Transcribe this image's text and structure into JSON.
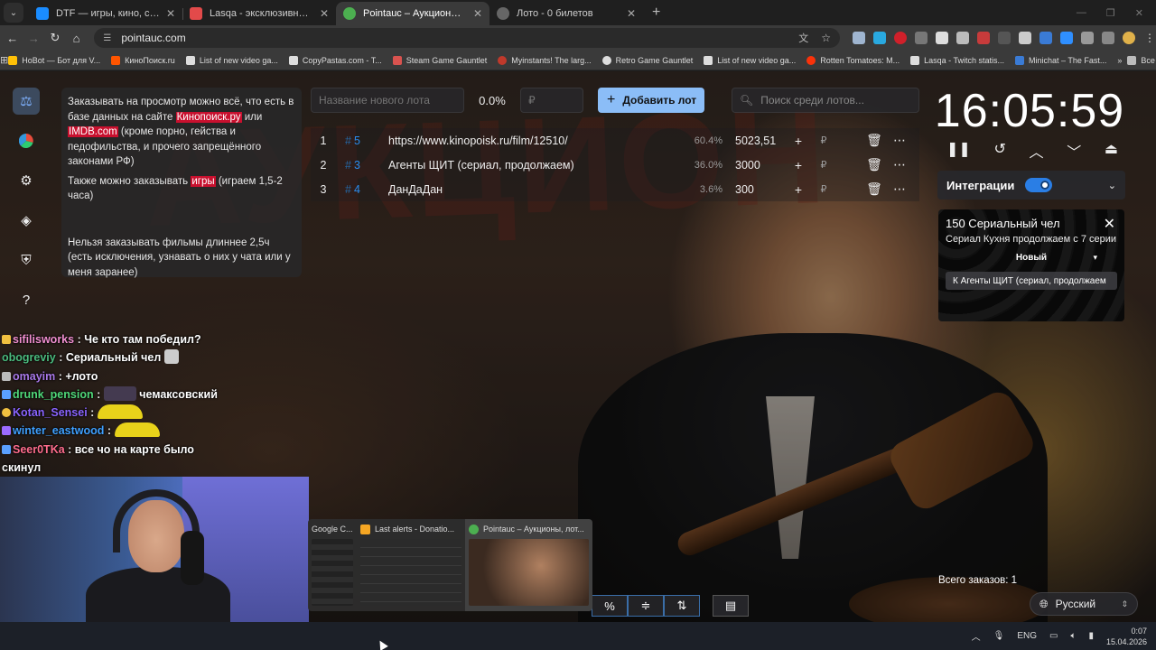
{
  "browser": {
    "tabs": [
      {
        "title": "DTF — игры, кино, сериалы, р",
        "icon": "dtf-icon",
        "color": "#1a8cff",
        "active": false
      },
      {
        "title": "Lasqa - эксклюзивный контен",
        "icon": "lasqa-icon",
        "color": "#e24a4a",
        "active": false
      },
      {
        "title": "Pointauc – Аукционы, лотере",
        "icon": "pointauc-icon",
        "color": "#4caf50",
        "active": true
      },
      {
        "title": "Лото - 0 билетов",
        "icon": "globe-icon",
        "color": "#888888",
        "active": false
      }
    ],
    "url": "pointauc.com",
    "bookmarks": [
      {
        "label": "HoBot — Бот для V...",
        "color": "#ffc107"
      },
      {
        "label": "КиноПоиск.ru",
        "color": "#ff5500"
      },
      {
        "label": "List of new video ga...",
        "color": "#dddddd"
      },
      {
        "label": "CopyPastas.com - T...",
        "color": "#dddddd"
      },
      {
        "label": "Steam Game Gauntlet",
        "color": "#d9534f"
      },
      {
        "label": "Myinstants! The larg...",
        "color": "#c0392b"
      },
      {
        "label": "Retro Game Gauntlet",
        "color": "#dddddd"
      },
      {
        "label": "List of new video ga...",
        "color": "#dddddd"
      },
      {
        "label": "Rotten Tomatoes: M...",
        "color": "#fa320a"
      },
      {
        "label": "Lasqa - Twitch statis...",
        "color": "#dddddd"
      },
      {
        "label": "Minichat – The Fast...",
        "color": "#3a7bd5"
      }
    ],
    "bookmarks_more": "»",
    "all_bookmarks": "Все закладки"
  },
  "info": {
    "p1_a": "Заказывать на просмотр можно всё, что есть в базе данных на сайте ",
    "p1_link1": "Кинопоиск.ру",
    "p1_b": " или ",
    "p1_link2": "IMDB.com",
    "p1_c": " (кроме порно, гейства и педофильства, и прочего запрещённого законами РФ)",
    "p2_a": "Также можно заказывать ",
    "p2_link": "игры",
    "p2_b": " (играем 1,5-2 часа)",
    "p3": "Нельзя заказывать фильмы длиннее 2,5ч (есть исключения, узнавать о них у чата или у меня заранее)"
  },
  "lot_form": {
    "name_placeholder": "Название нового лота",
    "percent": "0.0%",
    "amount_placeholder": "₽",
    "add_button": "Добавить лот",
    "search_placeholder": "Поиск среди лотов..."
  },
  "lots": [
    {
      "n": "1",
      "id": "5",
      "name": "https://www.kinopoisk.ru/film/12510/",
      "share": "60.4%",
      "amount": "5023,51"
    },
    {
      "n": "2",
      "id": "3",
      "name": "Агенты ЩИТ (сериал, продолжаем)",
      "share": "36.0%",
      "amount": "3000"
    },
    {
      "n": "3",
      "id": "4",
      "name": "ДанДаДан",
      "share": "3.6%",
      "amount": "300"
    }
  ],
  "timer": "16:05:59",
  "integrations": {
    "label": "Интеграции",
    "enabled": true
  },
  "donation_card": {
    "title": "150 Сериальный чел",
    "message": "Сериал Кухня продолжаем с 7 серии",
    "select_value": "Новый",
    "target_button": "К Агенты ЩИТ (сериал, продолжаем"
  },
  "total_orders": {
    "label": "Всего заказов:",
    "value": "1"
  },
  "language": "Русский",
  "chat": [
    {
      "user": "sifilisworks",
      "text": "Че кто там победил?",
      "ucls": "u1",
      "badge": "#f0c040"
    },
    {
      "user": "obogreviy",
      "text": "Сериальный чел",
      "ucls": "u2",
      "badge": ""
    },
    {
      "user": "omayim",
      "text": "+лото",
      "ucls": "u3",
      "badge": "#bbbbbb"
    },
    {
      "user": "drunk_pension",
      "text": "чемаксовский",
      "ucls": "u4",
      "badge": "#5aa0ff"
    },
    {
      "user": "Kotan_Sensei",
      "text": "",
      "ucls": "u5",
      "badge": "#f0c040"
    },
    {
      "user": "winter_eastwood",
      "text": "",
      "ucls": "u6",
      "badge": "#9b6bff"
    },
    {
      "user": "Seer0TKa",
      "text": "все чо на карте было",
      "ucls": "u7",
      "badge": "#5aa0ff"
    },
    {
      "user": "",
      "text": "скинул",
      "ucls": "u7",
      "badge": ""
    }
  ],
  "thumbnails": [
    {
      "title": "Google C...",
      "color": "#4285f4"
    },
    {
      "title": "Last alerts - Donatio...",
      "color": "#f5a623"
    },
    {
      "title": "Pointauc – Аукционы, лот...",
      "color": "#4caf50"
    }
  ],
  "tray": {
    "lang": "ENG",
    "time": "0:07",
    "date": "15.04.2026"
  }
}
